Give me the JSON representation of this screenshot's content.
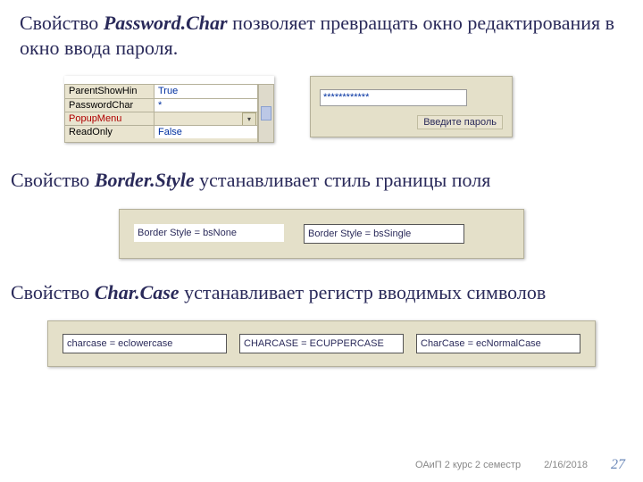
{
  "para1": {
    "pre": "Свойство ",
    "prop": "Password.Char",
    "post": " позволяет превращать окно редактирования в окно ввода пароля."
  },
  "propgrid": {
    "rows": [
      {
        "name": "ParentShowHin",
        "value": "True",
        "red": false
      },
      {
        "name": "PasswordChar",
        "value": "*",
        "red": false
      },
      {
        "name": "PopupMenu",
        "value": "",
        "red": true,
        "selected": true
      },
      {
        "name": "ReadOnly",
        "value": "False",
        "red": false
      }
    ]
  },
  "pw": {
    "masked": "************",
    "label": "Введите пароль"
  },
  "para2": {
    "pre": "Свойство ",
    "prop": "Border.Style",
    "post": " устанавливает стиль границы поля"
  },
  "bs": {
    "none": "Border Style = bsNone",
    "single": "Border Style = bsSingle"
  },
  "para3": {
    "pre": "Свойство ",
    "prop": "Char.Case",
    "post": " устанавливает регистр вводимых символов"
  },
  "cc": {
    "lower": "charcase = eclowercase",
    "upper": "CHARCASE = ECUPPERCASE",
    "normal": "CharCase = ecNormalCase"
  },
  "footer": {
    "course": "ОАиП 2 курс 2 семестр",
    "date": "2/16/2018",
    "page": "27"
  }
}
